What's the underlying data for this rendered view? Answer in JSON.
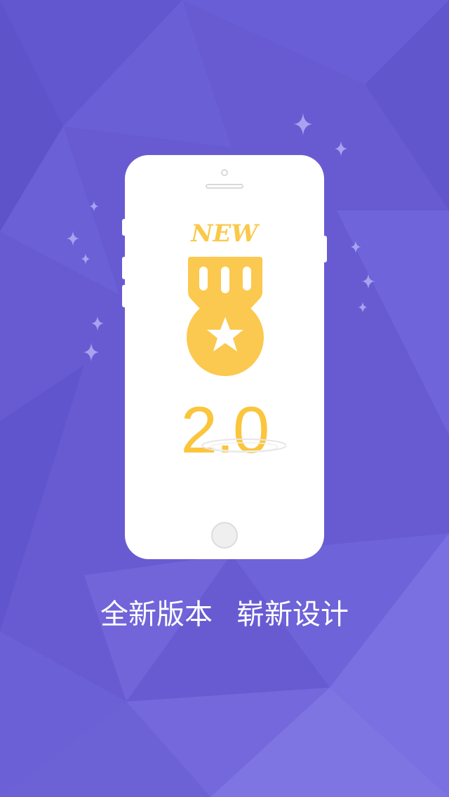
{
  "splash": {
    "badge_text": "NEW",
    "version": "2.0",
    "tagline_part1": "全新版本",
    "tagline_part2": "崭新设计"
  },
  "colors": {
    "background": "#6a5fd4",
    "accent_gold": "#fbc53c",
    "phone_body": "#ffffff"
  },
  "icons": [
    "sparkle-icon",
    "medal-icon",
    "star-icon"
  ]
}
